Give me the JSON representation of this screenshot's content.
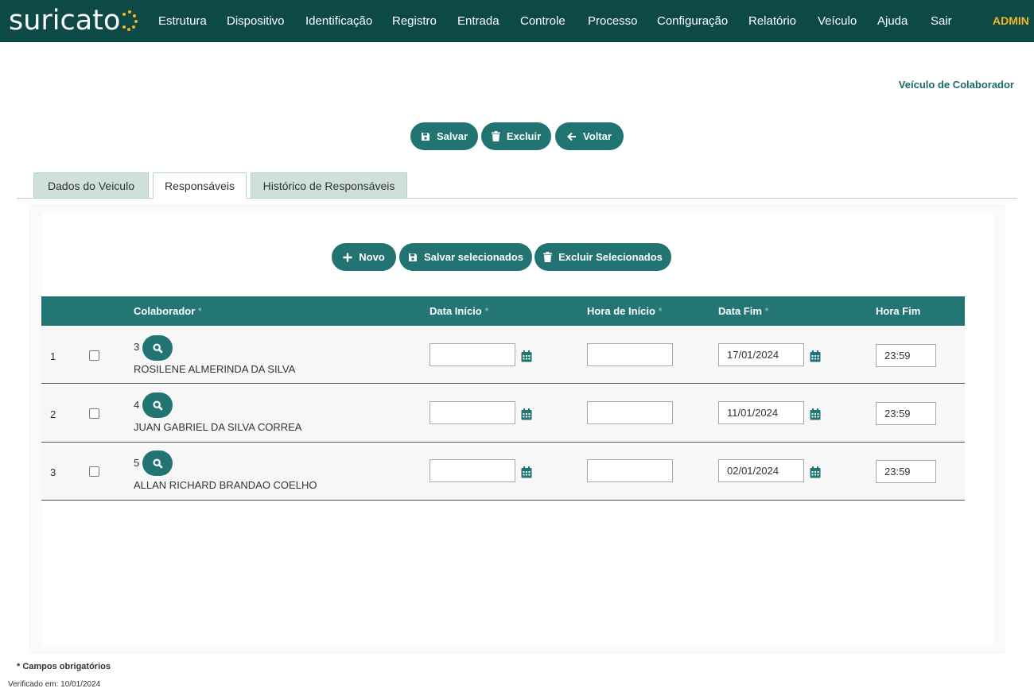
{
  "brand": {
    "logo_text": "suricato",
    "accent_color": "#f3b71d",
    "primary_color": "#217472",
    "nav_bg": "#0d4a47"
  },
  "nav": {
    "items": [
      "Estrutura",
      "Dispositivo",
      "Identificação",
      "Registro",
      "Entrada",
      "Controle",
      "Processo",
      "Configuração",
      "Relatório",
      "Veículo",
      "Ajuda",
      "Sair"
    ],
    "user": "ADMIN"
  },
  "page": {
    "title": "Veículo de Colaborador"
  },
  "toolbar": {
    "save_label": "Salvar",
    "delete_label": "Excluir",
    "back_label": "Voltar"
  },
  "tabs": [
    {
      "label": "Dados do Veiculo",
      "active": false
    },
    {
      "label": "Responsáveis",
      "active": true
    },
    {
      "label": "Histórico de Responsáveis",
      "active": false
    }
  ],
  "grid_toolbar": {
    "new_label": "Novo",
    "save_selected_label": "Salvar selecionados",
    "delete_selected_label": "Excluir Selecionados"
  },
  "table": {
    "headers": {
      "colaborador": "Colaborador",
      "data_inicio": "Data Início",
      "hora_inicio": "Hora de Início",
      "data_fim": "Data Fim",
      "hora_fim": "Hora Fim",
      "required_mark": "*"
    },
    "rows": [
      {
        "index": "1",
        "code": "3",
        "name": "ROSILENE ALMERINDA DA SILVA",
        "data_inicio": "",
        "hora_inicio": "",
        "data_fim": "17/01/2024",
        "hora_fim": "23:59",
        "checked": false
      },
      {
        "index": "2",
        "code": "4",
        "name": "JUAN GABRIEL DA SILVA CORREA",
        "data_inicio": "",
        "hora_inicio": "",
        "data_fim": "11/01/2024",
        "hora_fim": "23:59",
        "checked": false
      },
      {
        "index": "3",
        "code": "5",
        "name": "ALLAN RICHARD BRANDAO COELHO",
        "data_inicio": "",
        "hora_inicio": "",
        "data_fim": "02/01/2024",
        "hora_fim": "23:59",
        "checked": false
      }
    ]
  },
  "footer": {
    "required_note": "* Campos obrigatórios",
    "verified": "Verificado em: 10/01/2024"
  }
}
